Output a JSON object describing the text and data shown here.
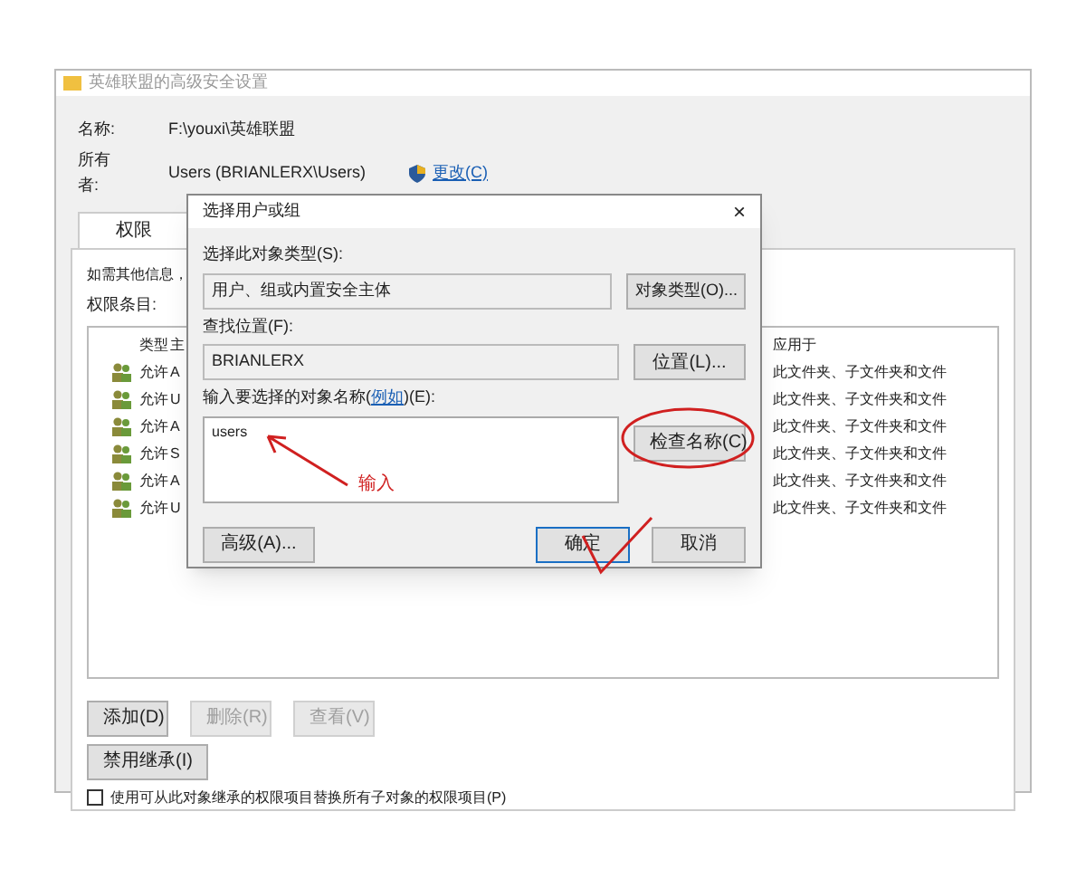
{
  "window": {
    "title": "英雄联盟的高级安全设置"
  },
  "name_label": "名称:",
  "name_value": "F:\\youxi\\英雄联盟",
  "owner_label": "所有者:",
  "owner_value": "Users (BRIANLERX\\Users)",
  "owner_change": "更改(C)",
  "tabs": [
    {
      "label": "权限",
      "selected": true
    }
  ],
  "info_text": "如需其他信息，",
  "entries_label": "权限条目:",
  "table": {
    "columns": [
      "类型",
      "主",
      "应用于"
    ],
    "rows": [
      {
        "type": "允许",
        "column_2": "A",
        "applies": "此文件夹、子文件夹和文件"
      },
      {
        "type": "允许",
        "column_2": "U",
        "applies": "此文件夹、子文件夹和文件"
      },
      {
        "type": "允许",
        "column_2": "A",
        "applies": "此文件夹、子文件夹和文件"
      },
      {
        "type": "允许",
        "column_2": "S",
        "applies": "此文件夹、子文件夹和文件"
      },
      {
        "type": "允许",
        "column_2": "A",
        "applies": "此文件夹、子文件夹和文件"
      },
      {
        "type": "允许",
        "column_2": "U",
        "applies": "此文件夹、子文件夹和文件"
      }
    ]
  },
  "buttons": [
    {
      "label": "添加(D)",
      "disabled": false
    },
    {
      "label": "删除(R)",
      "disabled": true
    },
    {
      "label": "查看(V)",
      "disabled": true
    }
  ],
  "disable_inheritance": "禁用继承(I)",
  "replace_checkbox": {
    "label": "使用可从此对象继承的权限项目替换所有子对象的权限项目(P)",
    "checked": false
  },
  "dialog": {
    "title": "选择用户或组",
    "close": "×",
    "type_label": "选择此对象类型(S):",
    "type_value": "用户、组或内置安全主体",
    "type_button": "对象类型(O)...",
    "location_label": "查找位置(F):",
    "location_value": "BRIANLERX",
    "location_button": "位置(L)...",
    "names_label_before": "输入要选择的对象名称(",
    "names_link": "例如",
    "names_label_after": ")(E):",
    "names_value": "users",
    "check_button": "检查名称(C)",
    "advanced_button": "高级(A)...",
    "ok_button": "确定",
    "cancel_button": "取消"
  },
  "annotation": {
    "text": "输入"
  }
}
